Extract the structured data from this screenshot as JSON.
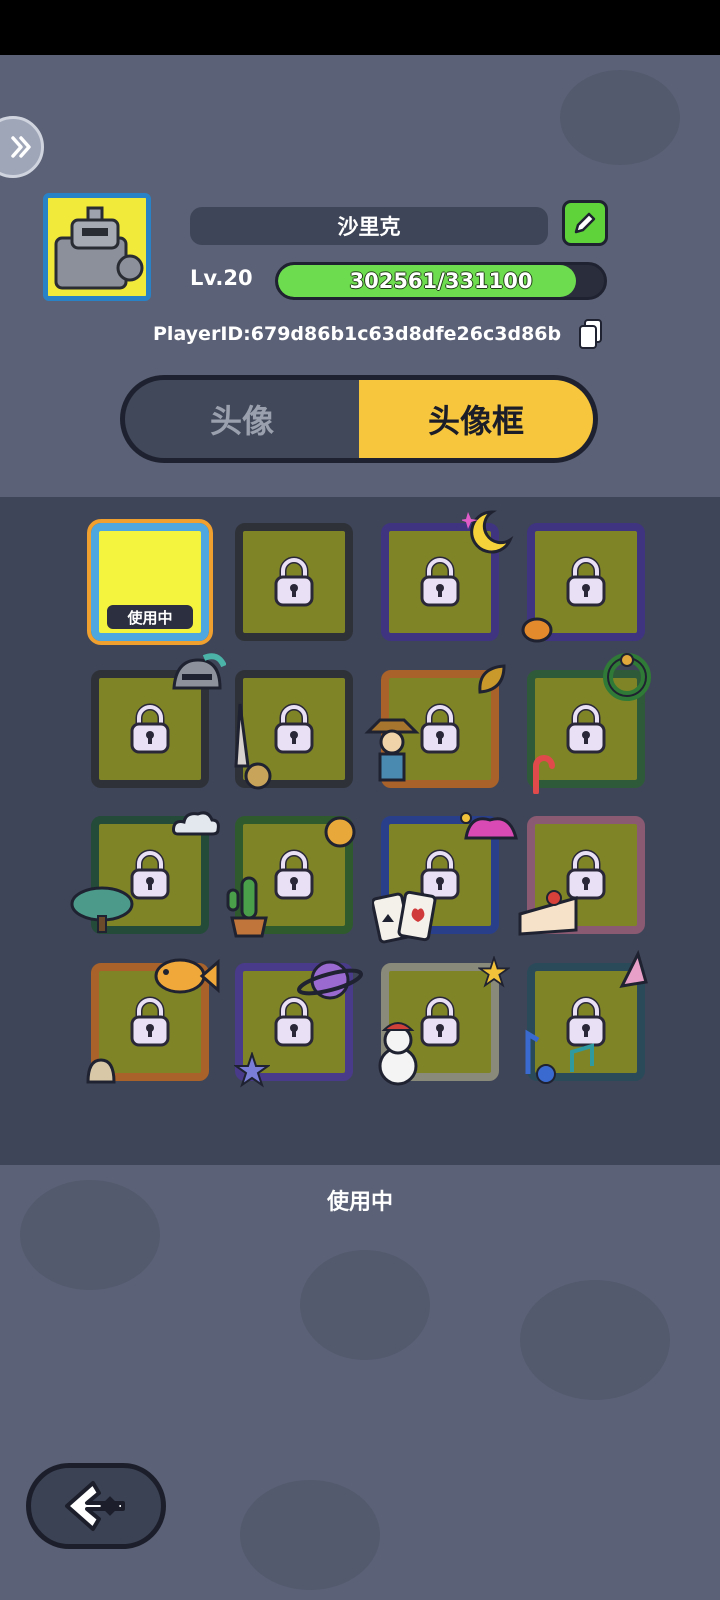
{
  "profile": {
    "name": "沙里克",
    "level_label": "Lv.20",
    "xp_text": "302561/331100",
    "xp_fraction": 0.914,
    "player_id_text": "PlayerID:679d86b1c63d8dfe26c3d86b"
  },
  "tabs": [
    {
      "label": "头像",
      "active": false
    },
    {
      "label": "头像框",
      "active": true
    }
  ],
  "frames": [
    {
      "name": "frame-default",
      "state": "selected",
      "badge": "使用中"
    },
    {
      "name": "frame-steel",
      "state": "locked"
    },
    {
      "name": "frame-moon",
      "state": "locked"
    },
    {
      "name": "frame-witch",
      "state": "locked"
    },
    {
      "name": "frame-knight",
      "state": "locked"
    },
    {
      "name": "frame-sword",
      "state": "locked"
    },
    {
      "name": "frame-scarecrow",
      "state": "locked"
    },
    {
      "name": "frame-christmas",
      "state": "locked"
    },
    {
      "name": "frame-bonsai",
      "state": "locked"
    },
    {
      "name": "frame-cactus",
      "state": "locked"
    },
    {
      "name": "frame-joker",
      "state": "locked"
    },
    {
      "name": "frame-cake",
      "state": "locked"
    },
    {
      "name": "frame-fish",
      "state": "locked"
    },
    {
      "name": "frame-planet",
      "state": "locked"
    },
    {
      "name": "frame-snowman",
      "state": "locked"
    },
    {
      "name": "frame-music",
      "state": "locked"
    }
  ],
  "status_text": "使用中",
  "colors": {
    "background": "#5b6176",
    "panel": "#3f4558",
    "active_tab": "#f8c63c",
    "xp_fill": "#6ddc4e",
    "edit_button": "#5fd43a",
    "selected_frame_border": "#4ea7de"
  },
  "icons": {
    "edit": "pencil-icon",
    "copy": "copy-icon",
    "back": "back-arrow-icon",
    "side": "double-chevron-icon",
    "lock": "lock-icon"
  }
}
